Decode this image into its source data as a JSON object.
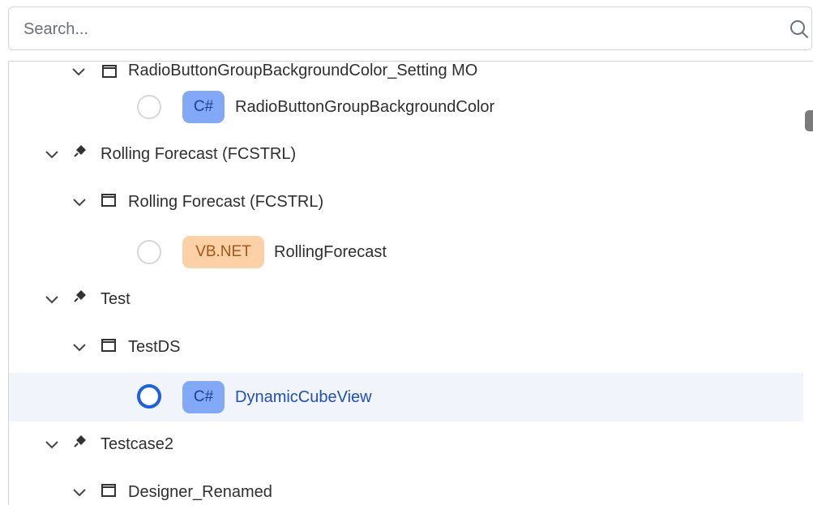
{
  "search": {
    "placeholder": "Search..."
  },
  "tree": {
    "rows": [
      {
        "kind": "folder",
        "label": "RadioButtonGroupBackgroundColor_Setting MO",
        "partial": true
      },
      {
        "kind": "item",
        "badge": "C#",
        "label": "RadioButtonGroupBackgroundColor",
        "selected": false
      },
      {
        "kind": "group",
        "label": "Rolling Forecast (FCSTRL)"
      },
      {
        "kind": "folder",
        "label": "Rolling Forecast (FCSTRL)"
      },
      {
        "kind": "item",
        "badge": "VB.NET",
        "label": "RollingForecast",
        "selected": false
      },
      {
        "kind": "group",
        "label": "Test"
      },
      {
        "kind": "folder",
        "label": "TestDS"
      },
      {
        "kind": "item",
        "badge": "C#",
        "label": "DynamicCubeView",
        "selected": true
      },
      {
        "kind": "group",
        "label": "Testcase2"
      },
      {
        "kind": "folder",
        "label": "Designer_Renamed"
      }
    ]
  },
  "colors": {
    "accent": "#1c5fe6",
    "cs_badge": "#82a9f7",
    "vbnet_badge": "#fcd1a6",
    "selected_row": "#f1f5fb"
  }
}
